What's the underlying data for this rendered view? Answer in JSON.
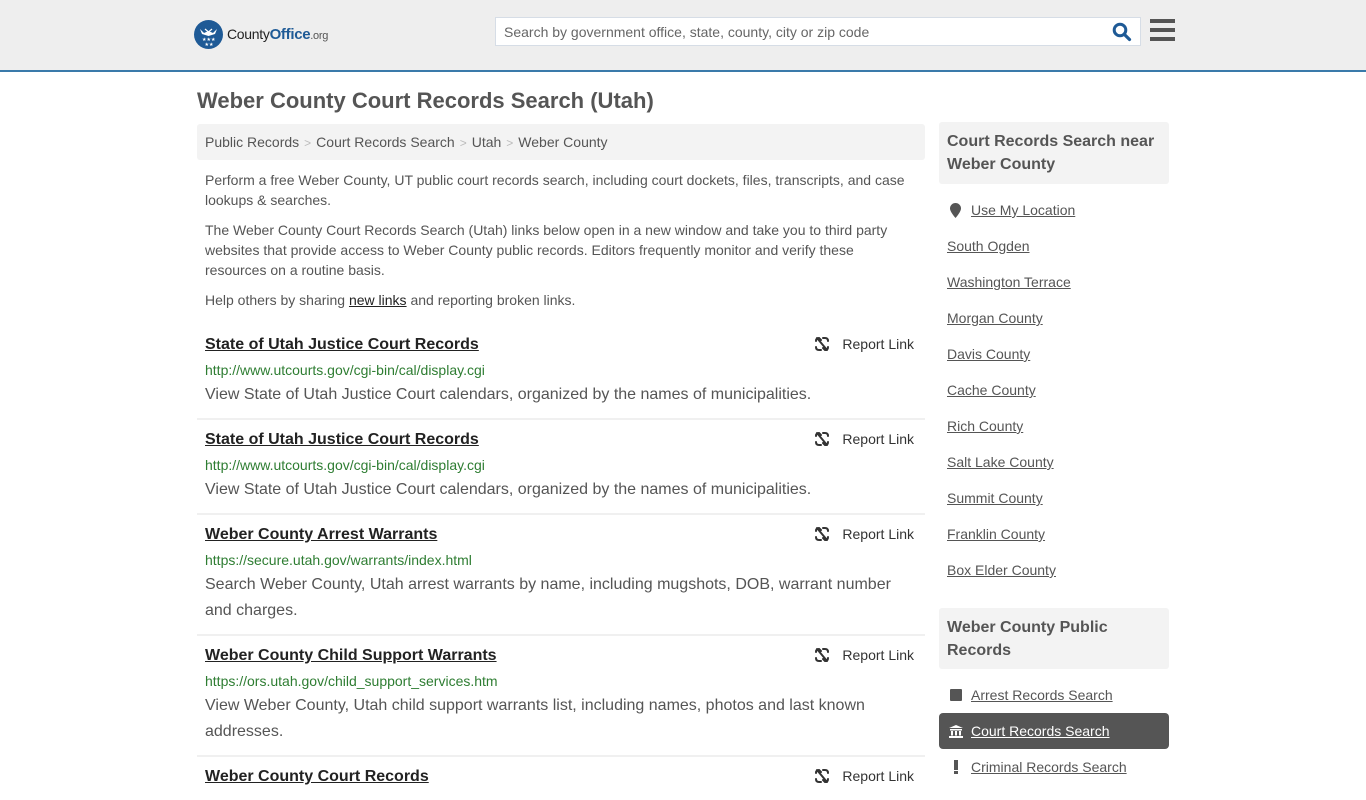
{
  "header": {
    "logo": {
      "county": "County",
      "office": "Office",
      "org": ".org",
      "icon": "eagle-stars-icon"
    },
    "search": {
      "placeholder": "Search by government office, state, county, city or zip code",
      "value": "",
      "icon": "search-icon"
    },
    "menu_icon": "hamburger-menu-icon",
    "accent_color": "#1e5a96",
    "border_color": "#3a7aaa"
  },
  "page": {
    "title": "Weber County Court Records Search (Utah)"
  },
  "breadcrumb": [
    {
      "label": "Public Records"
    },
    {
      "label": "Court Records Search"
    },
    {
      "label": "Utah"
    },
    {
      "label": "Weber County"
    }
  ],
  "breadcrumb_separator": ">",
  "intro": {
    "p1": "Perform a free Weber County, UT public court records search, including court dockets, files, transcripts, and case lookups & searches.",
    "p2": "The Weber County Court Records Search (Utah) links below open in a new window and take you to third party websites that provide access to Weber County public records. Editors frequently monitor and verify these resources on a routine basis.",
    "p3_before": "Help others by sharing ",
    "p3_link": "new links",
    "p3_after": " and reporting broken links."
  },
  "results": [
    {
      "title": "State of Utah Justice Court Records",
      "url": "http://www.utcourts.gov/cgi-bin/cal/display.cgi",
      "description": "View State of Utah Justice Court calendars, organized by the names of municipalities.",
      "report_label": "Report Link"
    },
    {
      "title": "State of Utah Justice Court Records",
      "url": "http://www.utcourts.gov/cgi-bin/cal/display.cgi",
      "description": "View State of Utah Justice Court calendars, organized by the names of municipalities.",
      "report_label": "Report Link"
    },
    {
      "title": "Weber County Arrest Warrants",
      "url": "https://secure.utah.gov/warrants/index.html",
      "description": "Search Weber County, Utah arrest warrants by name, including mugshots, DOB, warrant number and charges.",
      "report_label": "Report Link"
    },
    {
      "title": "Weber County Child Support Warrants",
      "url": "https://ors.utah.gov/child_support_services.htm",
      "description": "View Weber County, Utah child support warrants list, including names, photos and last known addresses.",
      "report_label": "Report Link"
    },
    {
      "title": "Weber County Court Records",
      "url": "",
      "description": "",
      "report_label": "Report Link"
    }
  ],
  "sidebar": {
    "nearby": {
      "heading": "Court Records Search near Weber County",
      "use_location": "Use My Location",
      "links": [
        "South Ogden",
        "Washington Terrace",
        "Morgan County",
        "Davis County",
        "Cache County",
        "Rich County",
        "Salt Lake County",
        "Summit County",
        "Franklin County",
        "Box Elder County"
      ]
    },
    "public_records": {
      "heading": "Weber County Public Records",
      "items": [
        {
          "label": "Arrest Records Search",
          "icon": "square-icon",
          "active": false
        },
        {
          "label": "Court Records Search",
          "icon": "courthouse-icon",
          "active": true
        },
        {
          "label": "Criminal Records Search",
          "icon": "exclamation-icon",
          "active": false
        }
      ]
    }
  }
}
